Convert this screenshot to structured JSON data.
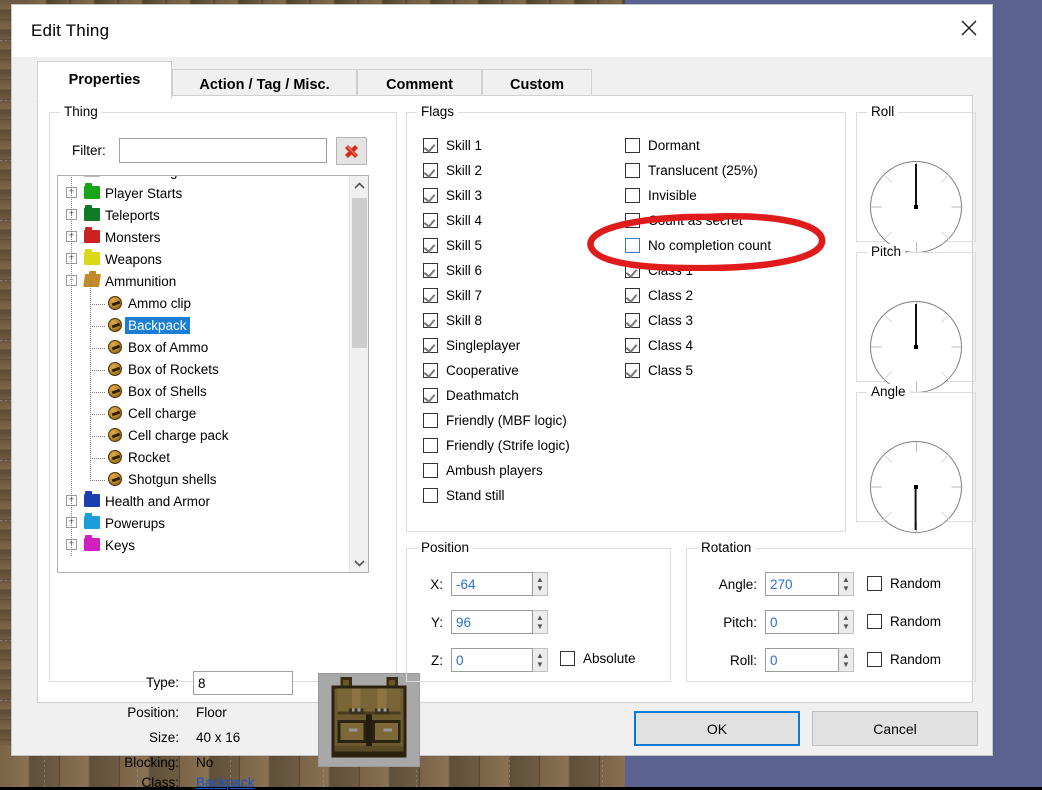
{
  "window": {
    "title": "Edit Thing",
    "close_icon": "close-icon"
  },
  "tabs": [
    {
      "label": "Properties",
      "active": true
    },
    {
      "label": "Action / Tag / Misc.",
      "active": false
    },
    {
      "label": "Comment",
      "active": false
    },
    {
      "label": "Custom",
      "active": false
    }
  ],
  "thing_group": {
    "title": "Thing",
    "filter_label": "Filter:",
    "filter_value": "",
    "filter_placeholder": "",
    "clear_button_icon": "red-x-icon",
    "tree": [
      {
        "label": "Editor Things",
        "kind": "folder",
        "folder_color": "#b9b9b9",
        "expander": "+",
        "depth": 0
      },
      {
        "label": "Player Starts",
        "kind": "folder",
        "folder_color": "#19a319",
        "expander": "+",
        "depth": 0
      },
      {
        "label": "Teleports",
        "kind": "folder",
        "folder_color": "#0f7a26",
        "expander": "+",
        "depth": 0
      },
      {
        "label": "Monsters",
        "kind": "folder",
        "folder_color": "#cc2222",
        "expander": "+",
        "depth": 0
      },
      {
        "label": "Weapons",
        "kind": "folder",
        "folder_color": "#d9d915",
        "expander": "+",
        "depth": 0
      },
      {
        "label": "Ammunition",
        "kind": "folder-open",
        "folder_color": "#c08a2a",
        "expander": "-",
        "depth": 0
      },
      {
        "label": "Ammo clip",
        "kind": "thing",
        "depth": 1
      },
      {
        "label": "Backpack",
        "kind": "thing",
        "depth": 1,
        "selected": true
      },
      {
        "label": "Box of Ammo",
        "kind": "thing",
        "depth": 1
      },
      {
        "label": "Box of Rockets",
        "kind": "thing",
        "depth": 1
      },
      {
        "label": "Box of Shells",
        "kind": "thing",
        "depth": 1
      },
      {
        "label": "Cell charge",
        "kind": "thing",
        "depth": 1
      },
      {
        "label": "Cell charge pack",
        "kind": "thing",
        "depth": 1
      },
      {
        "label": "Rocket",
        "kind": "thing",
        "depth": 1
      },
      {
        "label": "Shotgun shells",
        "kind": "thing",
        "depth": 1
      },
      {
        "label": "Health and Armor",
        "kind": "folder",
        "folder_color": "#1b3fb0",
        "expander": "+",
        "depth": 0
      },
      {
        "label": "Powerups",
        "kind": "folder",
        "folder_color": "#1b9ed8",
        "expander": "+",
        "depth": 0
      },
      {
        "label": "Keys",
        "kind": "folder",
        "folder_color": "#d020c0",
        "expander": "+",
        "depth": 0
      }
    ],
    "scrollbar": {
      "up_icon": "chevron-up-icon",
      "down_icon": "chevron-down-icon"
    },
    "info": {
      "type_label": "Type:",
      "type_value": "8",
      "position_label": "Position:",
      "position_value": "Floor",
      "size_label": "Size:",
      "size_value": "40 x 16",
      "blocking_label": "Blocking:",
      "blocking_value": "No",
      "class_label": "Class:",
      "class_value": "Backpack"
    },
    "sprite_name": "backpack-sprite"
  },
  "flags_group": {
    "title": "Flags",
    "left_column": [
      {
        "label": "Skill 1",
        "checked": true
      },
      {
        "label": "Skill 2",
        "checked": true
      },
      {
        "label": "Skill 3",
        "checked": true
      },
      {
        "label": "Skill 4",
        "checked": true
      },
      {
        "label": "Skill 5",
        "checked": true
      },
      {
        "label": "Skill 6",
        "checked": true
      },
      {
        "label": "Skill 7",
        "checked": true
      },
      {
        "label": "Skill 8",
        "checked": true
      },
      {
        "label": "Singleplayer",
        "checked": true
      },
      {
        "label": "Cooperative",
        "checked": true
      },
      {
        "label": "Deathmatch",
        "checked": true
      },
      {
        "label": "Friendly (MBF logic)",
        "checked": false
      },
      {
        "label": "Friendly (Strife logic)",
        "checked": false
      },
      {
        "label": "Ambush players",
        "checked": false
      },
      {
        "label": "Stand still",
        "checked": false
      }
    ],
    "right_column": [
      {
        "label": "Dormant",
        "checked": false
      },
      {
        "label": "Translucent (25%)",
        "checked": false
      },
      {
        "label": "Invisible",
        "checked": false
      },
      {
        "label": "Count as secret",
        "checked": false
      },
      {
        "label": "No completion count",
        "checked": false,
        "focused": true
      },
      {
        "label": "Class 1",
        "checked": true
      },
      {
        "label": "Class 2",
        "checked": true
      },
      {
        "label": "Class 3",
        "checked": true
      },
      {
        "label": "Class 4",
        "checked": true
      },
      {
        "label": "Class 5",
        "checked": true
      }
    ]
  },
  "dials": [
    {
      "title": "Roll",
      "value": 0,
      "needle_deg": 0
    },
    {
      "title": "Pitch",
      "value": 0,
      "needle_deg": 0
    },
    {
      "title": "Angle",
      "value": 270,
      "needle_deg": 180
    }
  ],
  "position_group": {
    "title": "Position",
    "fields": [
      {
        "label": "X:",
        "value": "-64"
      },
      {
        "label": "Y:",
        "value": "96"
      },
      {
        "label": "Z:",
        "value": "0"
      }
    ],
    "absolute_label": "Absolute",
    "absolute_checked": false
  },
  "rotation_group": {
    "title": "Rotation",
    "fields": [
      {
        "label": "Angle:",
        "value": "270",
        "random_label": "Random",
        "random_checked": false
      },
      {
        "label": "Pitch:",
        "value": "0",
        "random_label": "Random",
        "random_checked": false
      },
      {
        "label": "Roll:",
        "value": "0",
        "random_label": "Random",
        "random_checked": false
      }
    ]
  },
  "footer": {
    "ok_label": "OK",
    "cancel_label": "Cancel"
  },
  "annotation": {
    "kind": "hand-drawn-ellipse",
    "color": "#e01b1b",
    "targets": "No completion count"
  },
  "colors": {
    "accent_blue": "#0a7ad6",
    "selection_blue": "#1a7fd4",
    "link_blue": "#1155cc",
    "numeric_blue": "#2a6fd0",
    "dialog_bg": "#f0f0f0",
    "page_bg": "#ffffff",
    "annotation_red": "#e01b1b"
  }
}
